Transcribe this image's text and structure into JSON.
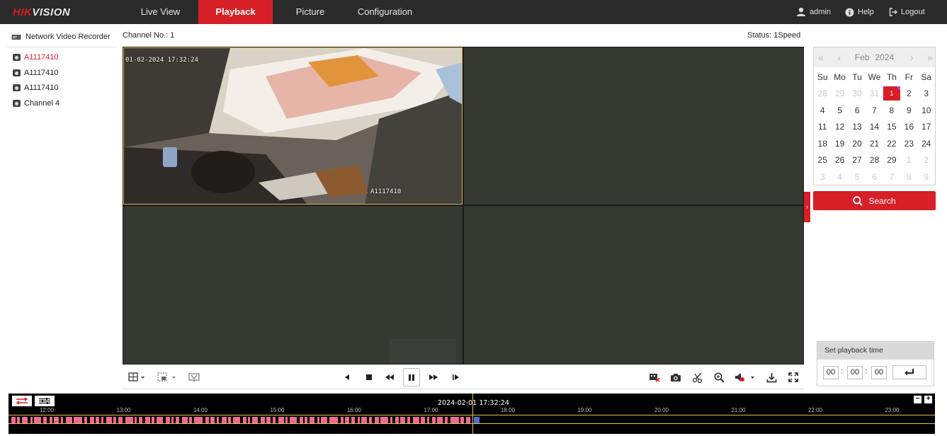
{
  "brand": {
    "logo_main": "HIK",
    "logo_accent": "VISION"
  },
  "nav": {
    "tabs": [
      {
        "label": "Live View"
      },
      {
        "label": "Playback"
      },
      {
        "label": "Picture"
      },
      {
        "label": "Configuration"
      }
    ],
    "active_tab": "Playback",
    "user": "admin",
    "help": "Help",
    "logout": "Logout"
  },
  "tree": {
    "root": "Network Video Recorder",
    "channels": [
      "A1117410",
      "A1117410",
      "A1117410",
      "Channel 4"
    ],
    "selected_index": 0
  },
  "header": {
    "channel_no": "Channel No.: 1",
    "status": "Status: 1Speed"
  },
  "video": {
    "osd_time": "01-02-2024 17:32:24",
    "osd_name": "A1117410"
  },
  "calendar": {
    "month": "Feb",
    "year": "2024",
    "weekdays": [
      "Su",
      "Mo",
      "Tu",
      "We",
      "Th",
      "Fr",
      "Sa"
    ],
    "weeks": [
      [
        "28",
        "29",
        "30",
        "31",
        "1",
        "2",
        "3"
      ],
      [
        "4",
        "5",
        "6",
        "7",
        "8",
        "9",
        "10"
      ],
      [
        "11",
        "12",
        "13",
        "14",
        "15",
        "16",
        "17"
      ],
      [
        "18",
        "19",
        "20",
        "21",
        "22",
        "23",
        "24"
      ],
      [
        "25",
        "26",
        "27",
        "28",
        "29",
        "1",
        "2"
      ],
      [
        "3",
        "4",
        "5",
        "6",
        "7",
        "8",
        "9"
      ]
    ],
    "selected_day": "1",
    "accent_color": "#d61f26"
  },
  "search": {
    "label": "Search"
  },
  "playback_time": {
    "title": "Set playback time",
    "hh": "00",
    "mm": "00",
    "ss": "00"
  },
  "timeline": {
    "current": "2024-02-01 17:32:24",
    "hours": [
      "12:00",
      "13:00",
      "14:00",
      "15:00",
      "16:00",
      "17:00",
      "18:00",
      "19:00",
      "20:00",
      "21:00",
      "22:00",
      "23:00"
    ],
    "record_color": "#ef6a94",
    "zoom_out": "−",
    "zoom_in": "+"
  }
}
